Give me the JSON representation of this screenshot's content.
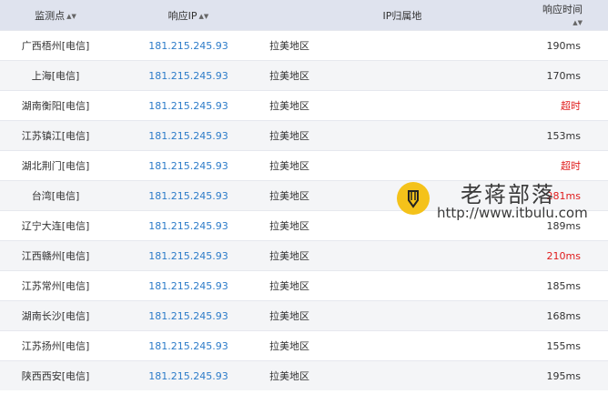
{
  "header": {
    "col_monitor": "监测点",
    "col_ip": "响应IP",
    "col_location": "IP归属地",
    "col_time": "响应时间"
  },
  "rows": [
    {
      "monitor": "广西梧州[电信]",
      "ip": "181.215.245.93",
      "location": "拉美地区",
      "time": "190ms",
      "timeout": false
    },
    {
      "monitor": "上海[电信]",
      "ip": "181.215.245.93",
      "location": "拉美地区",
      "time": "170ms",
      "timeout": false
    },
    {
      "monitor": "湖南衡阳[电信]",
      "ip": "181.215.245.93",
      "location": "拉美地区",
      "time": "超时",
      "timeout": true
    },
    {
      "monitor": "江苏镇江[电信]",
      "ip": "181.215.245.93",
      "location": "拉美地区",
      "time": "153ms",
      "timeout": false
    },
    {
      "monitor": "湖北荆门[电信]",
      "ip": "181.215.245.93",
      "location": "拉美地区",
      "time": "超时",
      "timeout": true
    },
    {
      "monitor": "台湾[电信]",
      "ip": "181.215.245.93",
      "location": "拉美地区",
      "time": "281ms",
      "timeout": true
    },
    {
      "monitor": "辽宁大连[电信]",
      "ip": "181.215.245.93",
      "location": "拉美地区",
      "time": "189ms",
      "timeout": false
    },
    {
      "monitor": "江西赣州[电信]",
      "ip": "181.215.245.93",
      "location": "拉美地区",
      "time": "210ms",
      "timeout": true
    },
    {
      "monitor": "江苏常州[电信]",
      "ip": "181.215.245.93",
      "location": "拉美地区",
      "time": "185ms",
      "timeout": false
    },
    {
      "monitor": "湖南长沙[电信]",
      "ip": "181.215.245.93",
      "location": "拉美地区",
      "time": "168ms",
      "timeout": false
    },
    {
      "monitor": "江苏扬州[电信]",
      "ip": "181.215.245.93",
      "location": "拉美地区",
      "time": "155ms",
      "timeout": false
    },
    {
      "monitor": "陕西西安[电信]",
      "ip": "181.215.245.93",
      "location": "拉美地区",
      "time": "195ms",
      "timeout": false
    }
  ],
  "watermark": {
    "title": "老蒋部落",
    "url": "http://www.itbulu.com",
    "logo_icon": "pen-icon"
  },
  "colors": {
    "ip": "#2d7cc9",
    "timeout": "#e01b1b",
    "header_bg": "#dfe3ee"
  }
}
